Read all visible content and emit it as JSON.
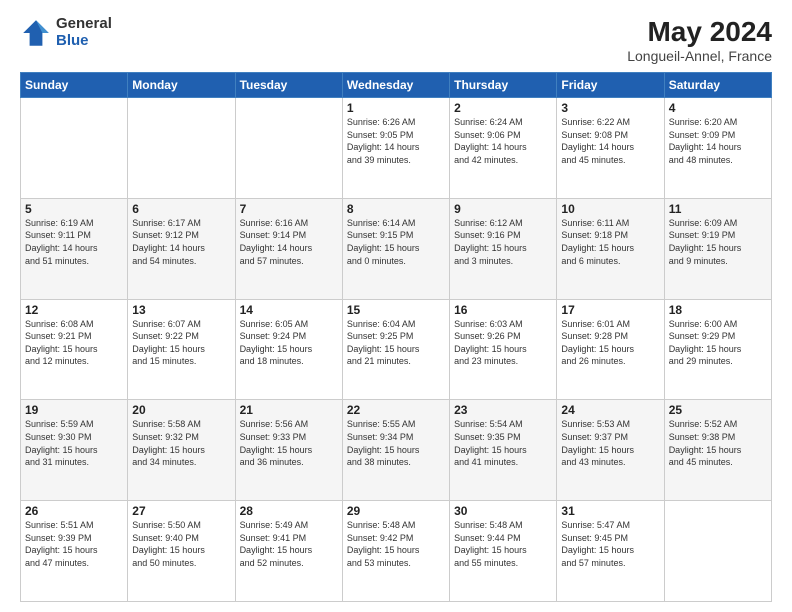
{
  "header": {
    "logo_general": "General",
    "logo_blue": "Blue",
    "title": "May 2024",
    "location": "Longueil-Annel, France"
  },
  "weekdays": [
    "Sunday",
    "Monday",
    "Tuesday",
    "Wednesday",
    "Thursday",
    "Friday",
    "Saturday"
  ],
  "weeks": [
    [
      {
        "day": "",
        "info": ""
      },
      {
        "day": "",
        "info": ""
      },
      {
        "day": "",
        "info": ""
      },
      {
        "day": "1",
        "info": "Sunrise: 6:26 AM\nSunset: 9:05 PM\nDaylight: 14 hours\nand 39 minutes."
      },
      {
        "day": "2",
        "info": "Sunrise: 6:24 AM\nSunset: 9:06 PM\nDaylight: 14 hours\nand 42 minutes."
      },
      {
        "day": "3",
        "info": "Sunrise: 6:22 AM\nSunset: 9:08 PM\nDaylight: 14 hours\nand 45 minutes."
      },
      {
        "day": "4",
        "info": "Sunrise: 6:20 AM\nSunset: 9:09 PM\nDaylight: 14 hours\nand 48 minutes."
      }
    ],
    [
      {
        "day": "5",
        "info": "Sunrise: 6:19 AM\nSunset: 9:11 PM\nDaylight: 14 hours\nand 51 minutes."
      },
      {
        "day": "6",
        "info": "Sunrise: 6:17 AM\nSunset: 9:12 PM\nDaylight: 14 hours\nand 54 minutes."
      },
      {
        "day": "7",
        "info": "Sunrise: 6:16 AM\nSunset: 9:14 PM\nDaylight: 14 hours\nand 57 minutes."
      },
      {
        "day": "8",
        "info": "Sunrise: 6:14 AM\nSunset: 9:15 PM\nDaylight: 15 hours\nand 0 minutes."
      },
      {
        "day": "9",
        "info": "Sunrise: 6:12 AM\nSunset: 9:16 PM\nDaylight: 15 hours\nand 3 minutes."
      },
      {
        "day": "10",
        "info": "Sunrise: 6:11 AM\nSunset: 9:18 PM\nDaylight: 15 hours\nand 6 minutes."
      },
      {
        "day": "11",
        "info": "Sunrise: 6:09 AM\nSunset: 9:19 PM\nDaylight: 15 hours\nand 9 minutes."
      }
    ],
    [
      {
        "day": "12",
        "info": "Sunrise: 6:08 AM\nSunset: 9:21 PM\nDaylight: 15 hours\nand 12 minutes."
      },
      {
        "day": "13",
        "info": "Sunrise: 6:07 AM\nSunset: 9:22 PM\nDaylight: 15 hours\nand 15 minutes."
      },
      {
        "day": "14",
        "info": "Sunrise: 6:05 AM\nSunset: 9:24 PM\nDaylight: 15 hours\nand 18 minutes."
      },
      {
        "day": "15",
        "info": "Sunrise: 6:04 AM\nSunset: 9:25 PM\nDaylight: 15 hours\nand 21 minutes."
      },
      {
        "day": "16",
        "info": "Sunrise: 6:03 AM\nSunset: 9:26 PM\nDaylight: 15 hours\nand 23 minutes."
      },
      {
        "day": "17",
        "info": "Sunrise: 6:01 AM\nSunset: 9:28 PM\nDaylight: 15 hours\nand 26 minutes."
      },
      {
        "day": "18",
        "info": "Sunrise: 6:00 AM\nSunset: 9:29 PM\nDaylight: 15 hours\nand 29 minutes."
      }
    ],
    [
      {
        "day": "19",
        "info": "Sunrise: 5:59 AM\nSunset: 9:30 PM\nDaylight: 15 hours\nand 31 minutes."
      },
      {
        "day": "20",
        "info": "Sunrise: 5:58 AM\nSunset: 9:32 PM\nDaylight: 15 hours\nand 34 minutes."
      },
      {
        "day": "21",
        "info": "Sunrise: 5:56 AM\nSunset: 9:33 PM\nDaylight: 15 hours\nand 36 minutes."
      },
      {
        "day": "22",
        "info": "Sunrise: 5:55 AM\nSunset: 9:34 PM\nDaylight: 15 hours\nand 38 minutes."
      },
      {
        "day": "23",
        "info": "Sunrise: 5:54 AM\nSunset: 9:35 PM\nDaylight: 15 hours\nand 41 minutes."
      },
      {
        "day": "24",
        "info": "Sunrise: 5:53 AM\nSunset: 9:37 PM\nDaylight: 15 hours\nand 43 minutes."
      },
      {
        "day": "25",
        "info": "Sunrise: 5:52 AM\nSunset: 9:38 PM\nDaylight: 15 hours\nand 45 minutes."
      }
    ],
    [
      {
        "day": "26",
        "info": "Sunrise: 5:51 AM\nSunset: 9:39 PM\nDaylight: 15 hours\nand 47 minutes."
      },
      {
        "day": "27",
        "info": "Sunrise: 5:50 AM\nSunset: 9:40 PM\nDaylight: 15 hours\nand 50 minutes."
      },
      {
        "day": "28",
        "info": "Sunrise: 5:49 AM\nSunset: 9:41 PM\nDaylight: 15 hours\nand 52 minutes."
      },
      {
        "day": "29",
        "info": "Sunrise: 5:48 AM\nSunset: 9:42 PM\nDaylight: 15 hours\nand 53 minutes."
      },
      {
        "day": "30",
        "info": "Sunrise: 5:48 AM\nSunset: 9:44 PM\nDaylight: 15 hours\nand 55 minutes."
      },
      {
        "day": "31",
        "info": "Sunrise: 5:47 AM\nSunset: 9:45 PM\nDaylight: 15 hours\nand 57 minutes."
      },
      {
        "day": "",
        "info": ""
      }
    ]
  ]
}
